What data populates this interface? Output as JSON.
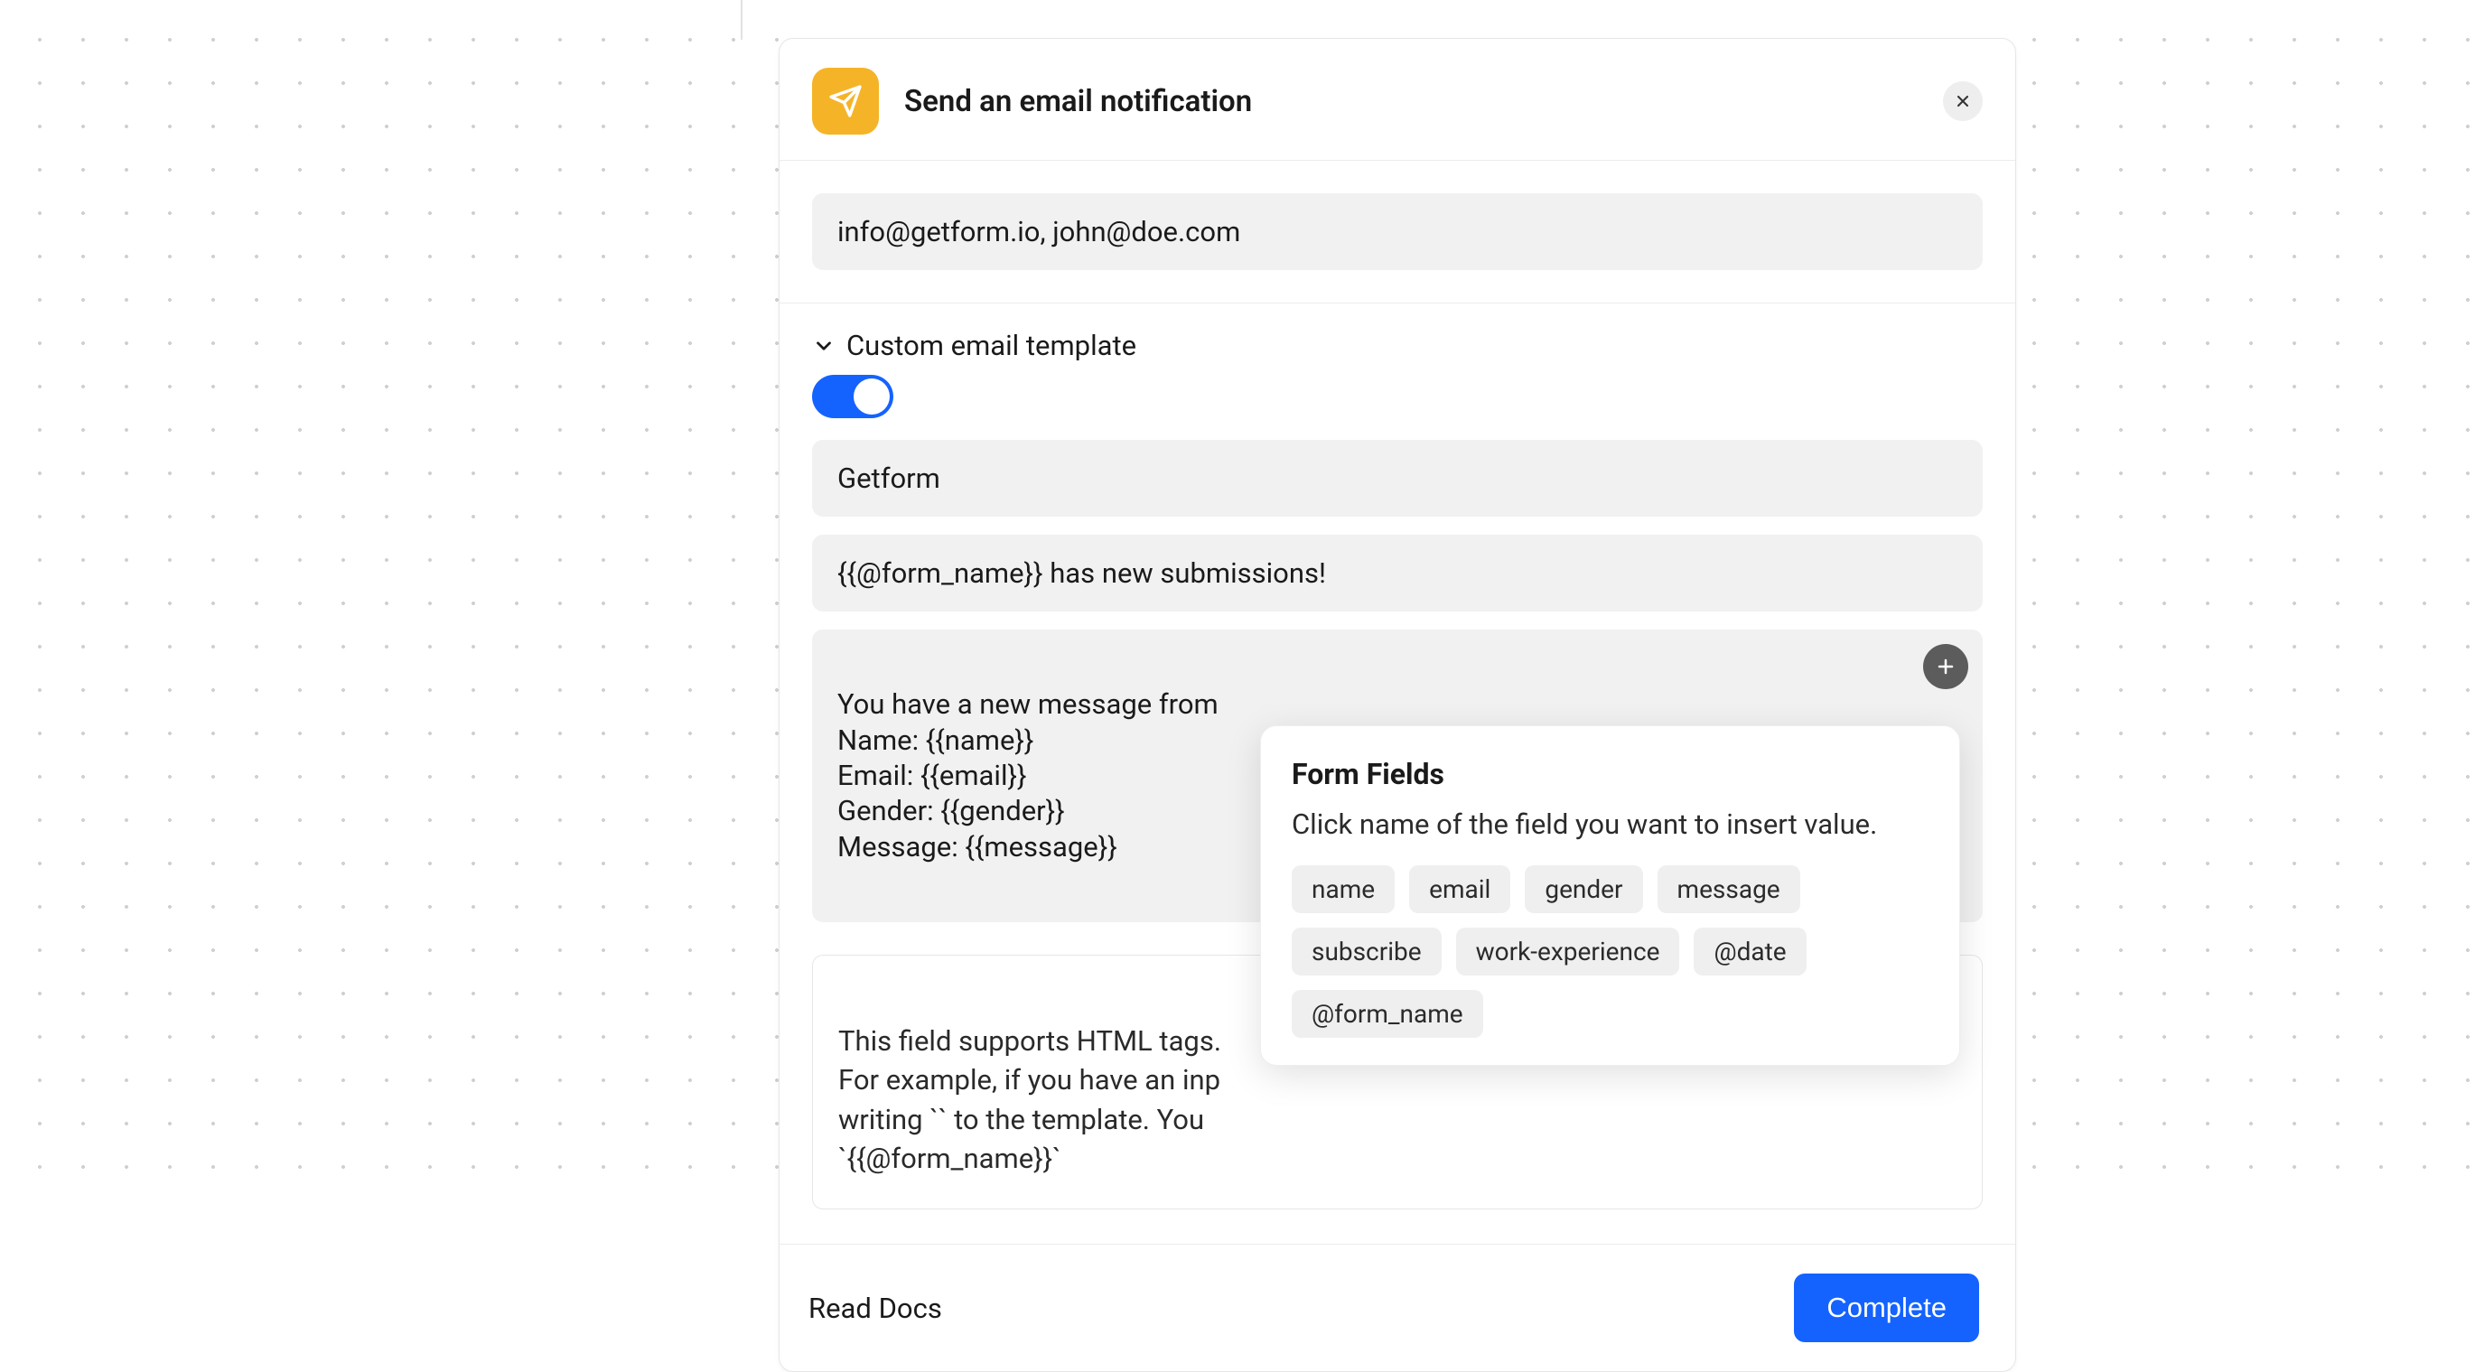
{
  "header": {
    "title": "Send an email notification"
  },
  "recipients": {
    "value": "info@getform.io, john@doe.com"
  },
  "template": {
    "collapse_label": "Custom email template",
    "toggle_on": true,
    "from_name": "Getform",
    "subject": "{{@form_name}} has new submissions!",
    "body": "You have a new message from\nName: {{name}}\nEmail: {{email}}\nGender: {{gender}}\nMessage: {{message}}",
    "help_text": "This field supports HTML tags.\nFor example, if you have an inp\nwriting `` to the template. You \n`{{@form_name}}`"
  },
  "footer": {
    "docs_label": "Read Docs",
    "complete_label": "Complete"
  },
  "popover": {
    "title": "Form Fields",
    "description": "Click name of the field you want to insert value.",
    "fields": [
      "name",
      "email",
      "gender",
      "message",
      "subscribe",
      "work-experience",
      "@date",
      "@form_name"
    ]
  },
  "colors": {
    "accent_blue": "#1463ff",
    "icon_yellow": "#f5b427"
  }
}
